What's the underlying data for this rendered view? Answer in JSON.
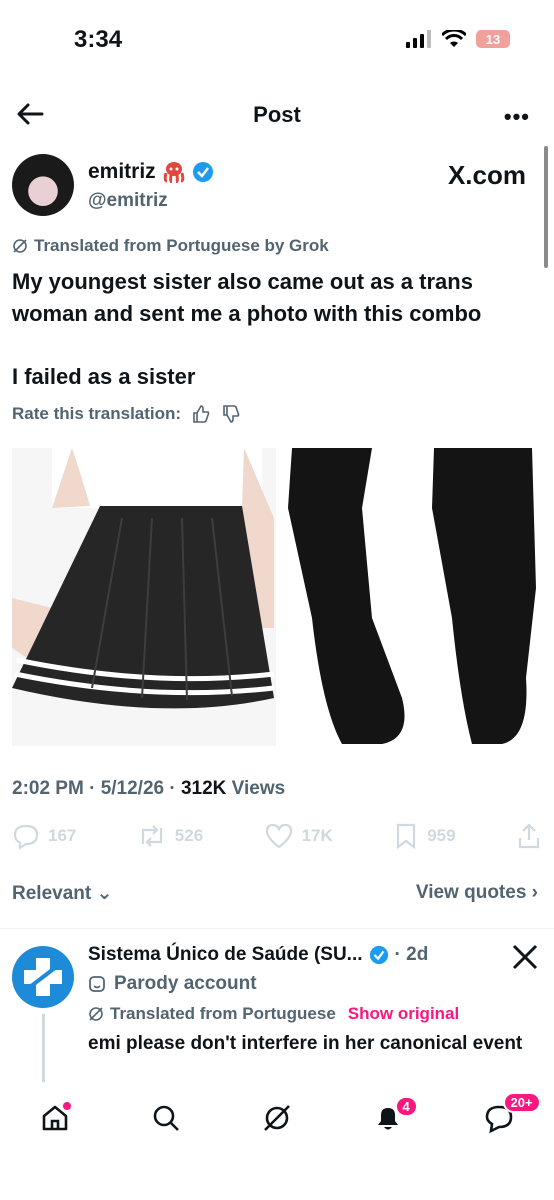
{
  "status": {
    "time": "3:34",
    "battery": "13"
  },
  "header": {
    "title": "Post"
  },
  "author": {
    "name": "emitriz",
    "handle": "@emitriz",
    "watermark": "X.com"
  },
  "post": {
    "translated_label": "Translated from Portuguese by Grok",
    "text_line1": "My youngest sister also came out as a trans woman and sent me a photo with this combo",
    "text_line2": "I failed as a sister",
    "rate_label": "Rate this translation:",
    "timestamp": "2:02 PM · 5/12/26 · ",
    "views_count": "312K",
    "views_label": " Views"
  },
  "actions": {
    "replies": "167",
    "reposts": "526",
    "likes": "17K",
    "bookmarks": "959"
  },
  "filters": {
    "sort": "Relevant",
    "quotes": "View quotes"
  },
  "reply": {
    "name": "Sistema Único de Saúde (SU...",
    "time": "· 2d",
    "parody": "Parody account",
    "translated": "Translated from Portuguese",
    "show_original": "Show original",
    "text": "emi please don't interfere in her canonical event"
  },
  "tabbar": {
    "notifications_badge": "4",
    "messages_badge": "20+"
  },
  "colors": {
    "accent": "#1d9bf0",
    "pink": "#f91880",
    "muted": "#536471"
  }
}
